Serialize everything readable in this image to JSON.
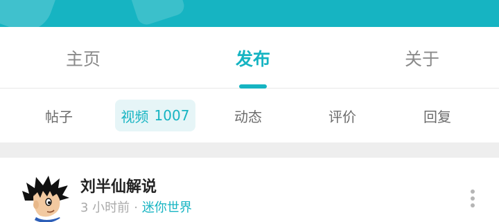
{
  "colors": {
    "accent": "#16b4c2",
    "active_chip_bg": "#e6f5f7",
    "muted_text": "#8a8a8a",
    "band": "#eeeeee"
  },
  "main_tabs": [
    {
      "label": "主页",
      "active": false
    },
    {
      "label": "发布",
      "active": true
    },
    {
      "label": "关于",
      "active": false
    }
  ],
  "sub_tabs": [
    {
      "label": "帖子",
      "count": null,
      "active": false
    },
    {
      "label": "视频",
      "count": "1007",
      "active": true
    },
    {
      "label": "动态",
      "count": null,
      "active": false
    },
    {
      "label": "评价",
      "count": null,
      "active": false
    },
    {
      "label": "回复",
      "count": null,
      "active": false
    }
  ],
  "post": {
    "author": "刘半仙解说",
    "time": "3 小时前",
    "separator": "·",
    "channel": "迷你世界",
    "more_icon": "more-vertical-icon"
  }
}
